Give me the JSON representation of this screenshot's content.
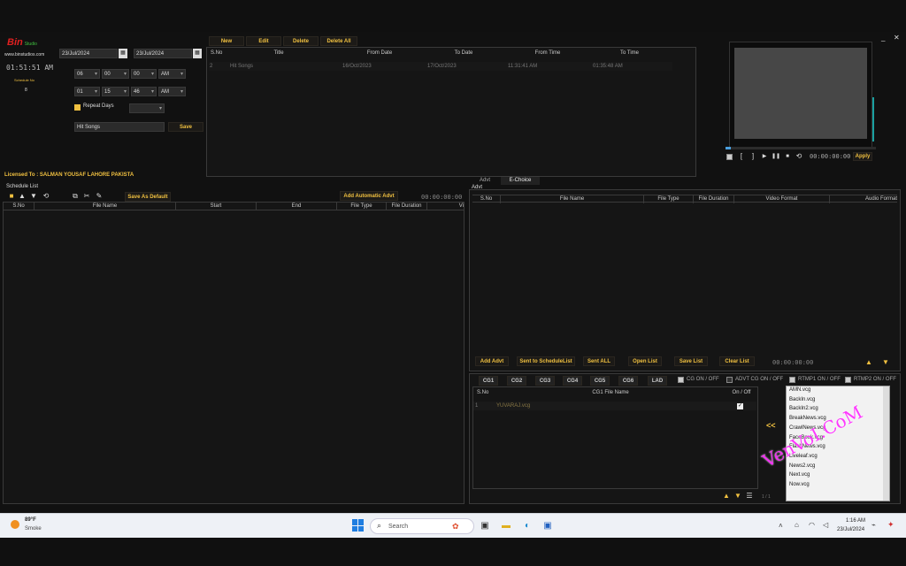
{
  "window": {
    "minimize": "_",
    "close": "✕"
  },
  "brand": {
    "logo_text": "Bin",
    "logo_sub": "Studio",
    "url": "www.binstudios.com",
    "clock": "01:51:51 AM",
    "schedule_label": "Schedule No",
    "schedule_no": "8"
  },
  "form": {
    "from_date": "23/Jul/2024",
    "to_date": "23/Jul/2024",
    "from_h": "06",
    "from_m": "00",
    "from_s": "00",
    "from_ampm": "AM",
    "to_h": "01",
    "to_m": "15",
    "to_s": "46",
    "to_ampm": "AM",
    "repeat_label": "Repeat Days",
    "repeat_value": "",
    "title_value": "Hit Songs",
    "save": "Save"
  },
  "toolbar": {
    "new": "New",
    "edit": "Edit",
    "delete": "Delete",
    "delete_all": "Delete All"
  },
  "schedule_table": {
    "headers": [
      "S.No",
      "Title",
      "From Date",
      "To Date",
      "From Time",
      "To Time"
    ],
    "rows": [
      {
        "sno": "2",
        "title": "Hit Songs",
        "from_date": "16/Oct/2023",
        "to_date": "17/Oct/2023",
        "from_time": "11:31:41 AM",
        "to_time": "01:35:48 AM"
      }
    ]
  },
  "preview": {
    "timecode": "00:00:00:00",
    "apply": "Apply"
  },
  "license": "Licensed To : SALMAN YOUSAF LAHORE PAKISTA",
  "schedule_list": {
    "title": "Schedule List",
    "save_default": "Save As Default",
    "add_auto": "Add Automatic Advt",
    "timecode": "00:00:00:00",
    "headers": [
      "S.No",
      "File Name",
      "Start",
      "End",
      "File Type",
      "File Duration",
      "Vi"
    ]
  },
  "tabs": {
    "advt": "Advt",
    "echoice": "E-Choice"
  },
  "advt": {
    "title": "Advt",
    "headers": [
      "S.No",
      "File Name",
      "File Type",
      "File Duration",
      "Video Format",
      "Audio Format"
    ],
    "buttons": {
      "add": "Add Advt",
      "sent": "Sent to ScheduleList",
      "sent_all": "Sent ALL",
      "open": "Open List",
      "save": "Save List",
      "clear": "Clear List"
    },
    "timecode": "00:00:00:00"
  },
  "cg": {
    "tabs": [
      "CG1",
      "CG2",
      "CG3",
      "CG4",
      "CG5",
      "CG6",
      "LAD"
    ],
    "toggles": [
      "CG ON / OFF",
      "ADVT CG ON / OFF",
      "RTMP1 ON / OFF",
      "RTMP2 ON / OFF"
    ],
    "headers": [
      "S.No",
      "CG1 File Name",
      "On / Off"
    ],
    "rows": [
      {
        "sno": "1",
        "name": "YUVARAJ.vcg"
      }
    ],
    "move_label": "<<",
    "page": "1 / 1",
    "files": [
      "AMN.vcg",
      "BackIn.vcg",
      "BackIn2.vcg",
      "BreakNews.vcg",
      "CrawlNews.vcg",
      "FaceBook.vcg",
      "FlashNews.vcg",
      "Liveleaf.vcg",
      "News2.vcg",
      "Next.vcg",
      "Now.vcg"
    ]
  },
  "watermark": "VenVoI.CoM",
  "taskbar": {
    "temp": "89°F",
    "weather": "Smoke",
    "search": "Search",
    "time": "1:16 AM",
    "date": "23/Jul/2024"
  }
}
